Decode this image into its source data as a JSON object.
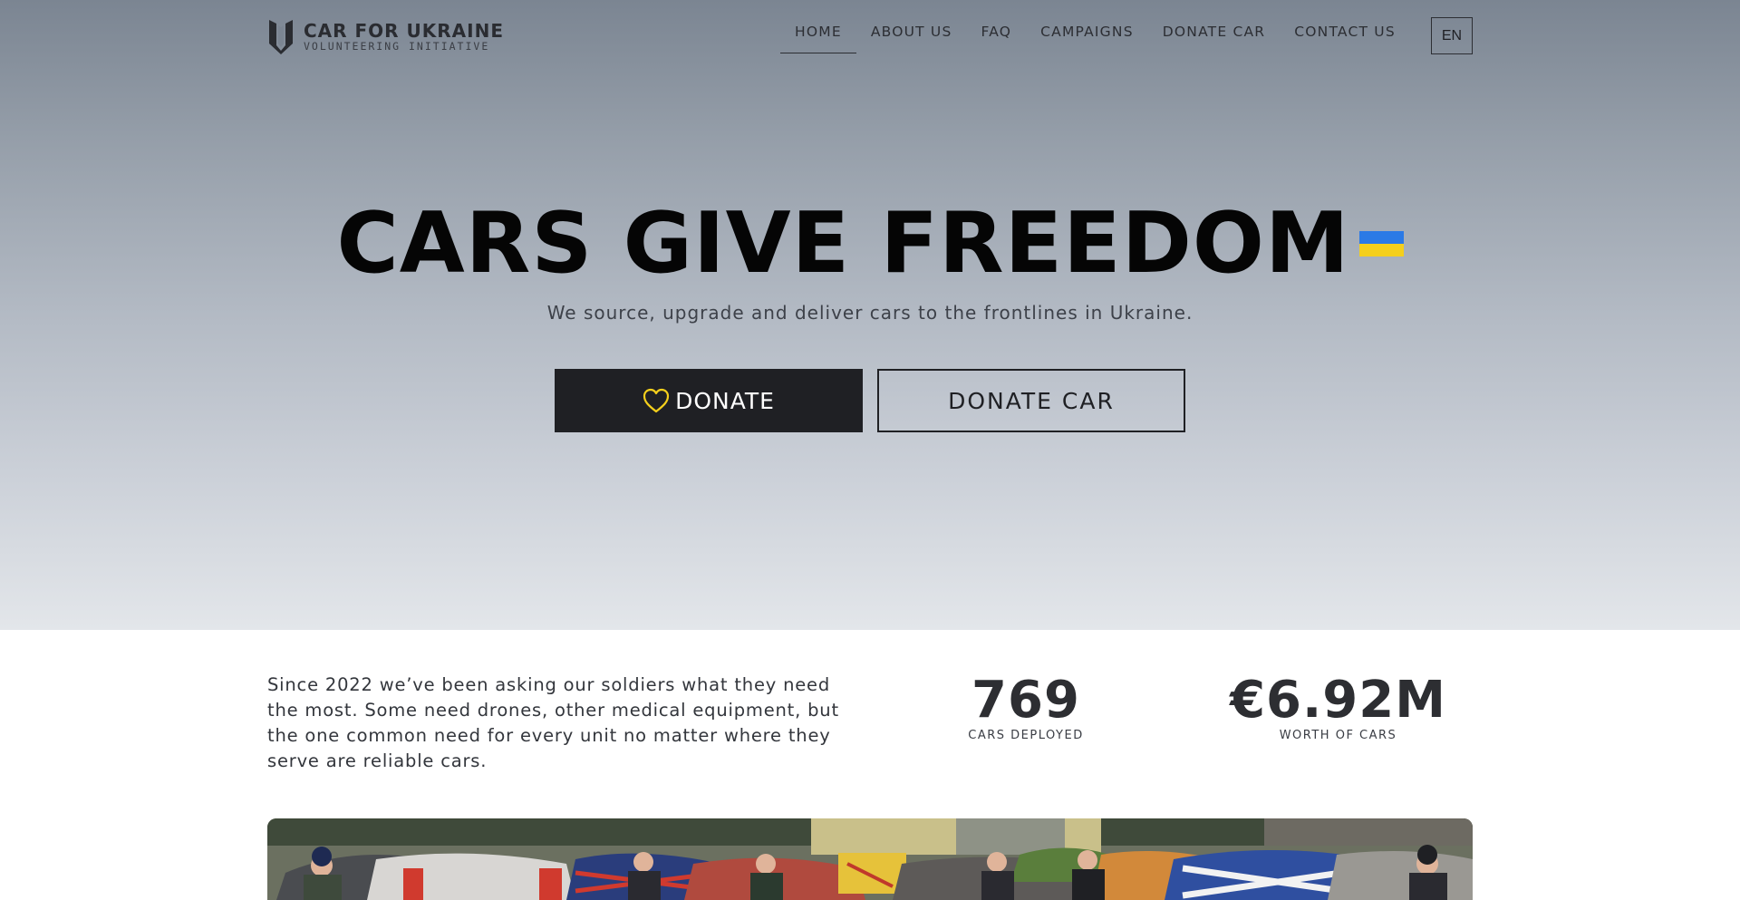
{
  "header": {
    "logo_title": "CAR FOR UKRAINE",
    "logo_subtitle": "VOLUNTEERING INITIATIVE",
    "nav": [
      {
        "label": "HOME",
        "active": true
      },
      {
        "label": "ABOUT US",
        "active": false
      },
      {
        "label": "FAQ",
        "active": false
      },
      {
        "label": "CAMPAIGNS",
        "active": false
      },
      {
        "label": "DONATE CAR",
        "active": false
      },
      {
        "label": "CONTACT US",
        "active": false
      }
    ],
    "language": "EN"
  },
  "hero": {
    "title": "CARS GIVE FREEDOM",
    "subtitle": "We source, upgrade and deliver cars to the frontlines in Ukraine.",
    "donate_label": "DONATE",
    "donate_car_label": "DONATE CAR",
    "flag_colors": {
      "top": "#2b7ae6",
      "bottom": "#f4cf1c"
    },
    "heart_icon_color": "#f4cf1c"
  },
  "info": {
    "intro_text": "Since 2022 we’ve been asking our soldiers what they need the most. Some need drones, other medical equipment, but the one common need for every unit no matter where they serve are reliable cars.",
    "stats": [
      {
        "value": "769",
        "label": "CARS DEPLOYED"
      },
      {
        "value": "€6.92M",
        "label": "WORTH OF CARS"
      }
    ]
  },
  "photo": {
    "description_icon": "group-photo-image"
  }
}
